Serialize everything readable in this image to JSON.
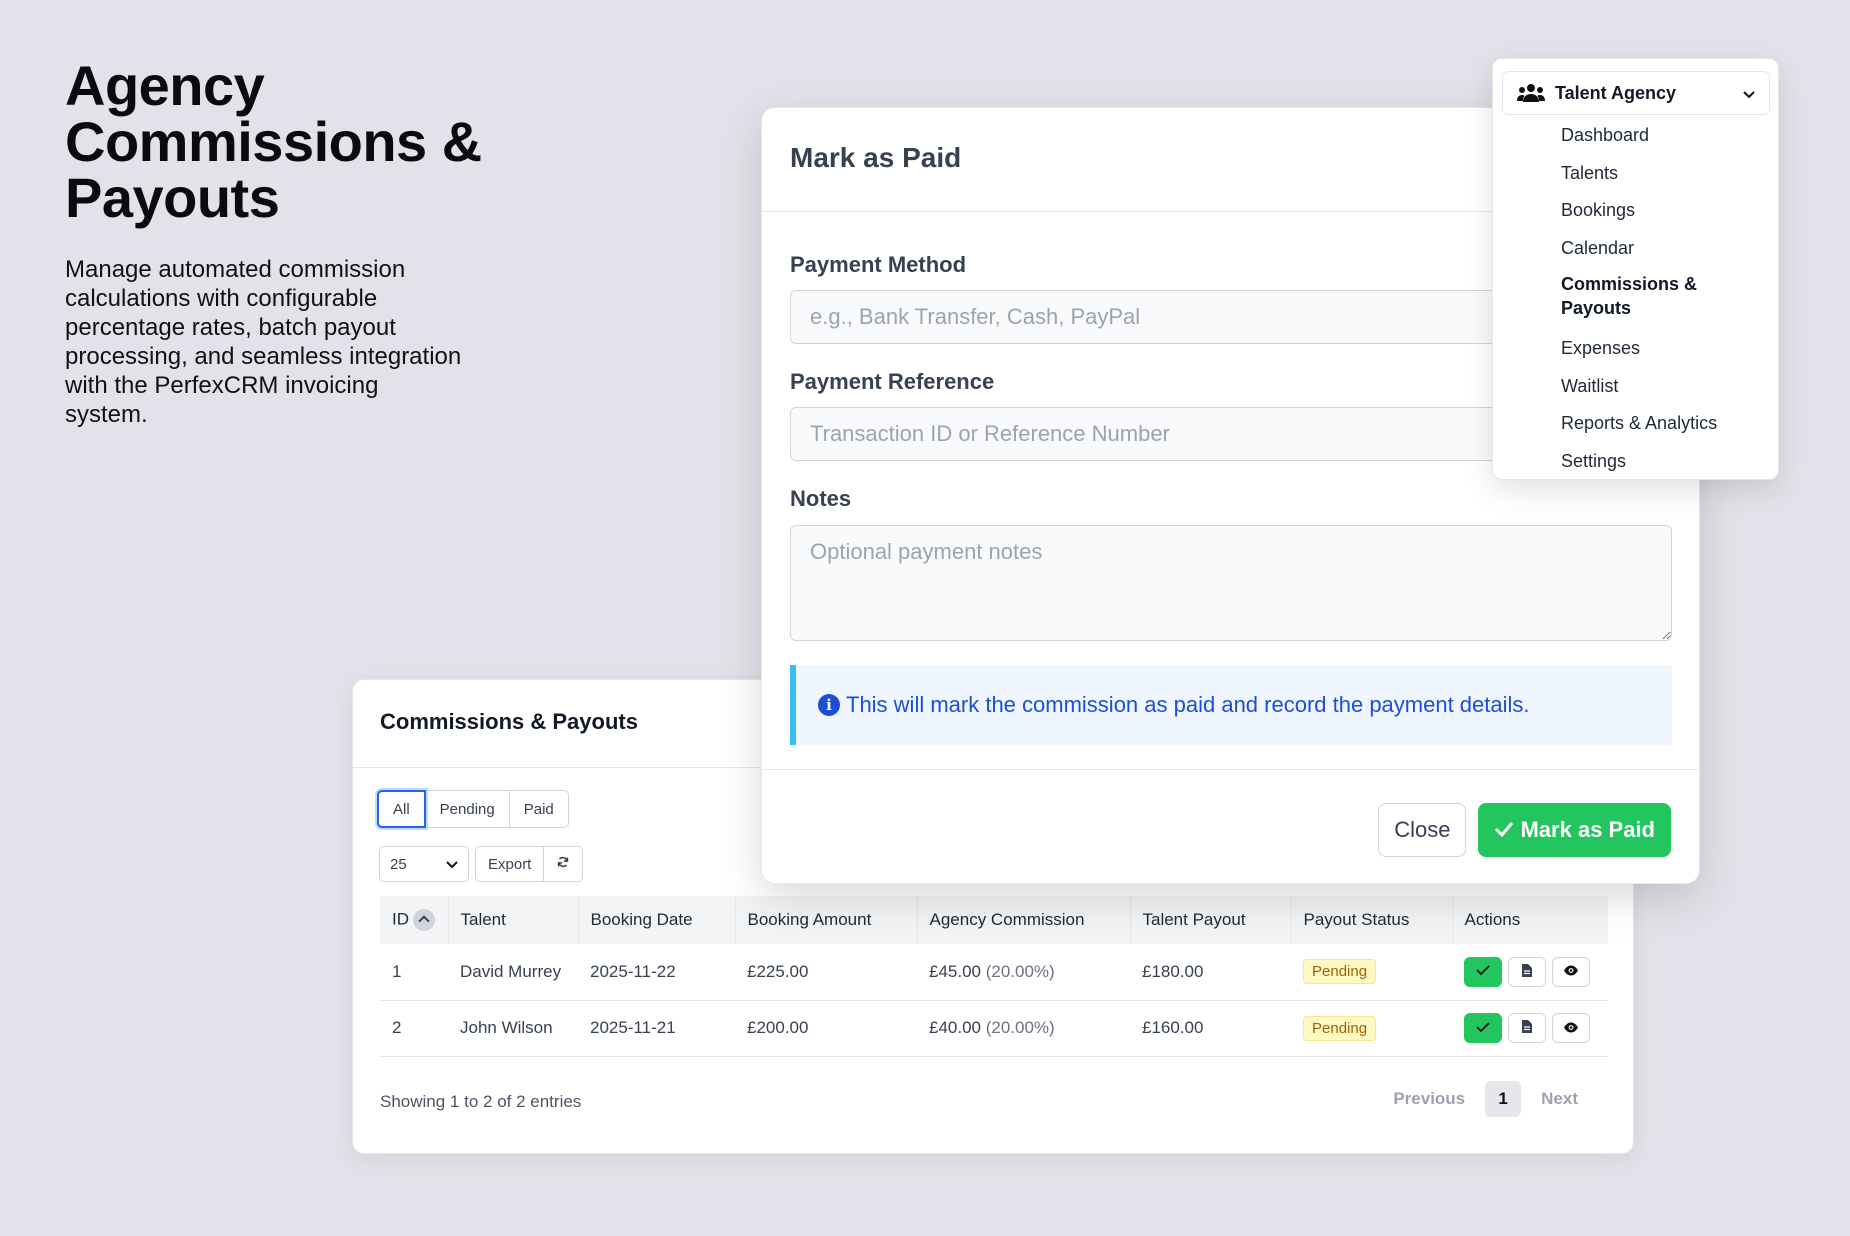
{
  "hero": {
    "title": "Agency Commissions & Payouts",
    "description": "Manage automated commission calculations with configurable percentage rates, batch payout processing, and seamless integration with the PerfexCRM invoicing system."
  },
  "card": {
    "title": "Commissions & Payouts",
    "filters": [
      "All",
      "Pending",
      "Paid"
    ],
    "active_filter": "All",
    "page_size": "25",
    "export_label": "Export",
    "columns": [
      "ID",
      "Talent",
      "Booking Date",
      "Booking Amount",
      "Agency Commission",
      "Talent Payout",
      "Payout Status",
      "Actions"
    ],
    "rows": [
      {
        "id": "1",
        "talent": "David Murrey",
        "date": "2025-11-22",
        "amount": "£225.00",
        "commission": "£45.00",
        "rate": "(20.00%)",
        "payout": "£180.00",
        "status": "Pending"
      },
      {
        "id": "2",
        "talent": "John Wilson",
        "date": "2025-11-21",
        "amount": "£200.00",
        "commission": "£40.00",
        "rate": "(20.00%)",
        "payout": "£160.00",
        "status": "Pending"
      }
    ],
    "showing": "Showing 1 to 2 of 2 entries",
    "pager": {
      "previous": "Previous",
      "current": "1",
      "next": "Next"
    }
  },
  "modal": {
    "title": "Mark as Paid",
    "method_label": "Payment Method",
    "method_placeholder": "e.g., Bank Transfer, Cash, PayPal",
    "reference_label": "Payment Reference",
    "reference_placeholder": "Transaction ID or Reference Number",
    "notes_label": "Notes",
    "notes_placeholder": "Optional payment notes",
    "alert": "This will mark the commission as paid and record the payment details.",
    "close_label": "Close",
    "submit_label": "Mark as Paid"
  },
  "nav": {
    "header": "Talent Agency",
    "items": [
      "Dashboard",
      "Talents",
      "Bookings",
      "Calendar",
      "Commissions & Payouts",
      "Expenses",
      "Waitlist",
      "Reports & Analytics",
      "Settings"
    ],
    "active": "Commissions & Payouts"
  },
  "colors": {
    "accent_green": "#22c55e",
    "info_blue": "#1d4ed8",
    "pending_badge": "#fef9c3"
  }
}
